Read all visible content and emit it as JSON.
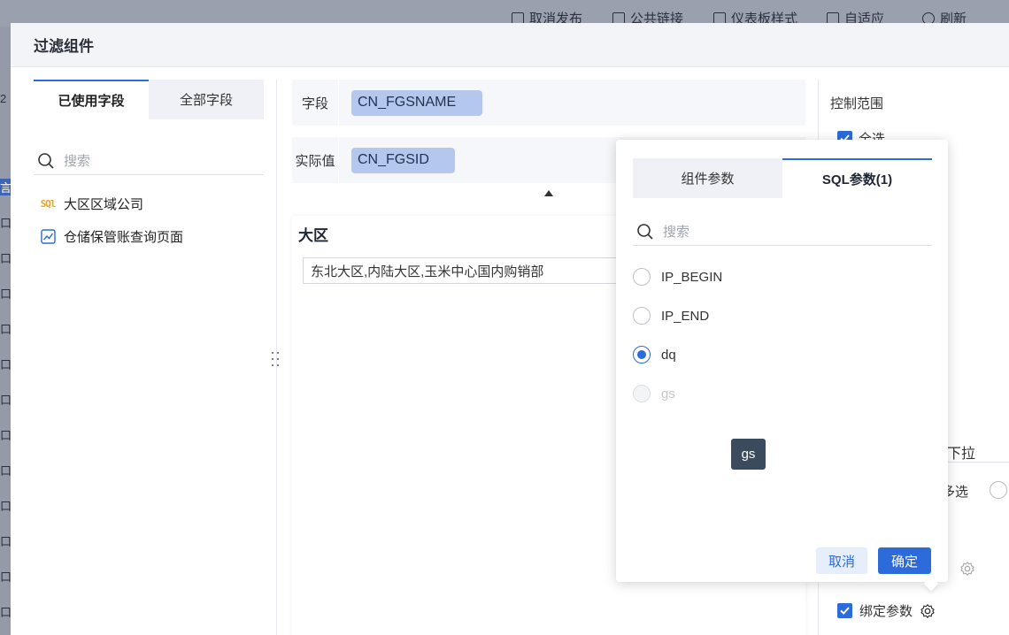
{
  "background": {
    "toolbar": [
      "取消发布",
      "公共链接",
      "仪表板样式",
      "自适应",
      "刷新"
    ],
    "left_strip": [
      "2",
      "言",
      "口",
      "口",
      "口",
      "口",
      "口",
      "口",
      "口",
      "口",
      "口",
      "口",
      "口",
      "口"
    ]
  },
  "modal": {
    "title": "过滤组件"
  },
  "left_pane": {
    "tabs": [
      "已使用字段",
      "全部字段"
    ],
    "search_placeholder": "搜索",
    "items": [
      {
        "label": "大区区域公司",
        "icon": "sql-icon"
      },
      {
        "label": "仓储保管账查询页面",
        "icon": "chart-icon"
      }
    ]
  },
  "middle": {
    "field_label": "字段",
    "field_value": "CN_FGSNAME",
    "actual_label": "实际值",
    "actual_value": "CN_FGSID",
    "preview_title": "大区",
    "preview_value": "东北大区,内陆大区,玉米中心国内购销部"
  },
  "right_pane": {
    "control_range_label": "控制范围",
    "select_all_label": "全选",
    "dropdown_partial": "下拉",
    "multi_partial": "多选",
    "bind_param_label": "绑定参数"
  },
  "popover": {
    "tabs": [
      "组件参数",
      "SQL参数(1)"
    ],
    "search_placeholder": "搜索",
    "params": [
      {
        "label": "IP_BEGIN",
        "state": "unchecked"
      },
      {
        "label": "IP_END",
        "state": "unchecked"
      },
      {
        "label": "dq",
        "state": "checked"
      },
      {
        "label": "gs",
        "state": "disabled"
      }
    ],
    "tooltip": "gs",
    "cancel_label": "取消",
    "confirm_label": "确定"
  },
  "colors": {
    "accent": "#2c6bd9",
    "chip": "#b4c8ee",
    "tooltip_bg": "#3c4a5e"
  }
}
